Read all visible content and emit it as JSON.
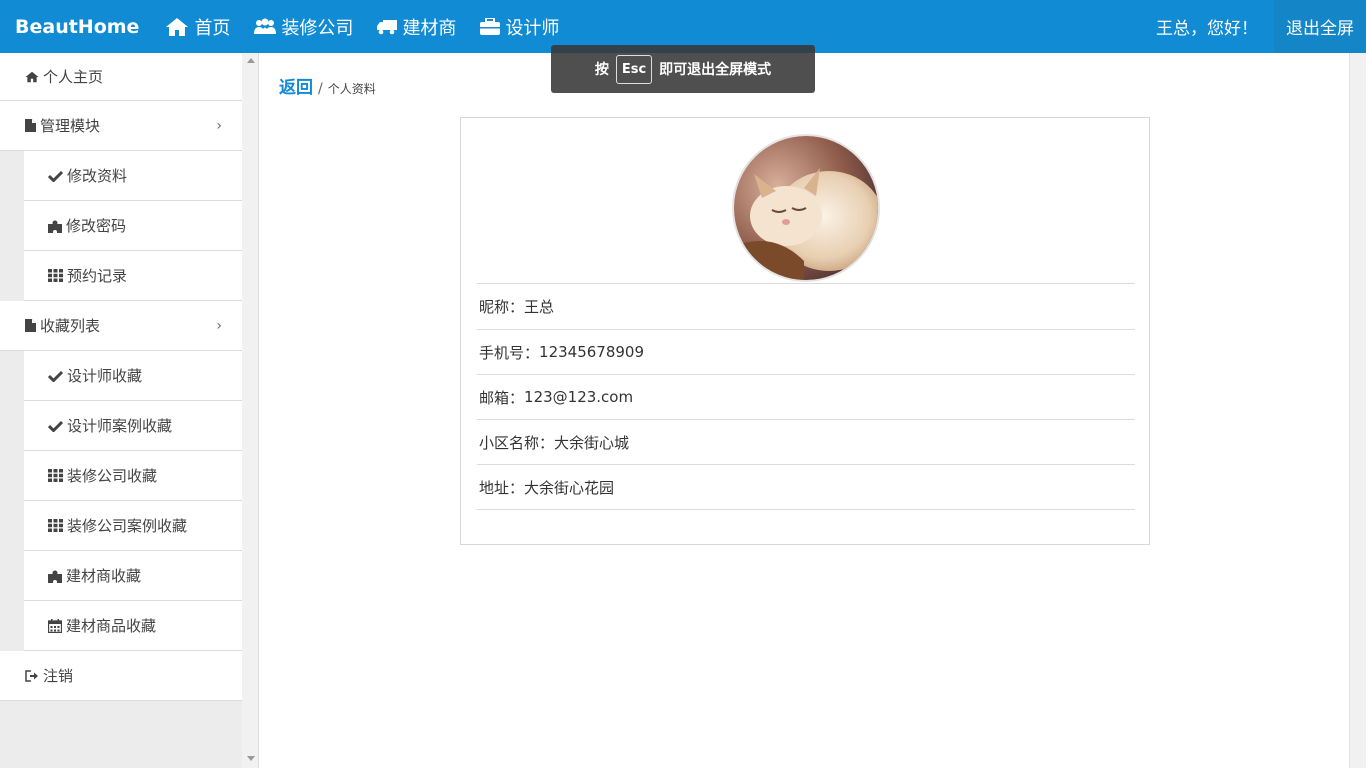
{
  "header": {
    "brand": "BeautHome",
    "nav": [
      {
        "label": "首页",
        "icon": "home-icon"
      },
      {
        "label": "装修公司",
        "icon": "users-icon"
      },
      {
        "label": "建材商",
        "icon": "truck-icon"
      },
      {
        "label": "设计师",
        "icon": "briefcase-icon"
      }
    ],
    "greeting": "王总，您好！",
    "exit_fullscreen": "退出全屏"
  },
  "esc_toast": {
    "prefix": "按",
    "key": "Esc",
    "suffix": "即可退出全屏模式"
  },
  "sidebar": {
    "home": {
      "label": "个人主页",
      "icon": "home-icon"
    },
    "manage": {
      "label": "管理模块",
      "icon": "file-icon",
      "items": [
        {
          "label": "修改资料",
          "icon": "check-icon"
        },
        {
          "label": "修改密码",
          "icon": "puzzle-icon"
        },
        {
          "label": "预约记录",
          "icon": "grid-icon"
        }
      ]
    },
    "favorites": {
      "label": "收藏列表",
      "icon": "file-icon",
      "items": [
        {
          "label": "设计师收藏",
          "icon": "check-icon"
        },
        {
          "label": "设计师案例收藏",
          "icon": "check-icon"
        },
        {
          "label": "装修公司收藏",
          "icon": "grid-icon"
        },
        {
          "label": "装修公司案例收藏",
          "icon": "grid-icon"
        },
        {
          "label": "建材商收藏",
          "icon": "puzzle-icon"
        },
        {
          "label": "建材商品收藏",
          "icon": "calendar-icon"
        }
      ]
    },
    "logout": {
      "label": "注销",
      "icon": "sign-out-icon"
    }
  },
  "breadcrumb": {
    "back": "返回",
    "separator": "/",
    "current": "个人资料"
  },
  "profile": {
    "avatar_desc": "cat-photo",
    "rows": [
      {
        "label": "昵称",
        "value": "王总"
      },
      {
        "label": "手机号",
        "value": "12345678909"
      },
      {
        "label": "邮箱",
        "value": "123@123.com"
      },
      {
        "label": "小区名称",
        "value": "大余街心城"
      },
      {
        "label": "地址",
        "value": "大余街心花园"
      }
    ],
    "separator": "："
  },
  "colors": {
    "header_bg": "#118bd4",
    "link": "#118bd4",
    "sidebar_bg": "#ececec"
  }
}
